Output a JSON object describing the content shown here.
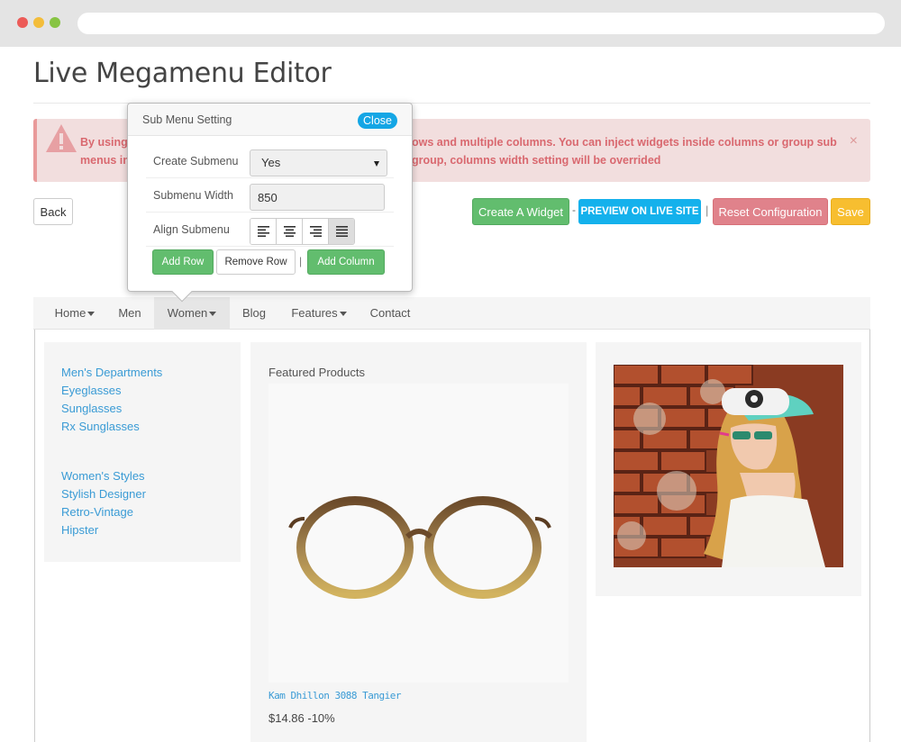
{
  "page": {
    "title": "Live Megamenu Editor"
  },
  "alert": {
    "line1_a": "By using",
    "line1_b": "ows and multiple columns. You can inject widgets inside columns or group sub",
    "line2_a": "menus in",
    "line2_b": "group, columns width setting will be overrided",
    "close": "×"
  },
  "toolbar": {
    "back": "Back",
    "create_widget": "Create A Widget",
    "sep1": "-",
    "preview": "PREVIEW ON LIVE SITE",
    "sep2": "|",
    "reset": "Reset Configuration",
    "save": "Save"
  },
  "menu": {
    "items": [
      {
        "label": "Home",
        "has_caret": true
      },
      {
        "label": "Men",
        "has_caret": false
      },
      {
        "label": "Women",
        "has_caret": true,
        "active": true
      },
      {
        "label": "Blog",
        "has_caret": false
      },
      {
        "label": "Features",
        "has_caret": true
      },
      {
        "label": "Contact",
        "has_caret": false
      }
    ]
  },
  "dropdown": {
    "links_group1": [
      "Men's Departments",
      "Eyeglasses",
      "Sunglasses",
      "Rx Sunglasses"
    ],
    "links_group2": [
      "Women's Styles",
      "Stylish Designer",
      "Retro-Vintage",
      "Hipster"
    ],
    "featured_title": "Featured Products",
    "product_name": "Kam Dhillon 3088 Tangier",
    "product_price": "$14.86 -10%"
  },
  "popup": {
    "title": "Sub Menu Setting",
    "close": "Close",
    "create_submenu_label": "Create Submenu",
    "create_submenu_value": "Yes",
    "submenu_width_label": "Submenu Width",
    "submenu_width_value": "850",
    "align_label": "Align Submenu",
    "align_active": "justify",
    "add_row": "Add Row",
    "remove_row": "Remove Row",
    "sep": "|",
    "add_column": "Add Column"
  },
  "colors": {
    "link": "#3a9bd5",
    "success": "#62bd6e",
    "info": "#14b1ec",
    "danger": "#e0828b",
    "warning": "#f7be30",
    "alert_bg": "#f2dede"
  }
}
